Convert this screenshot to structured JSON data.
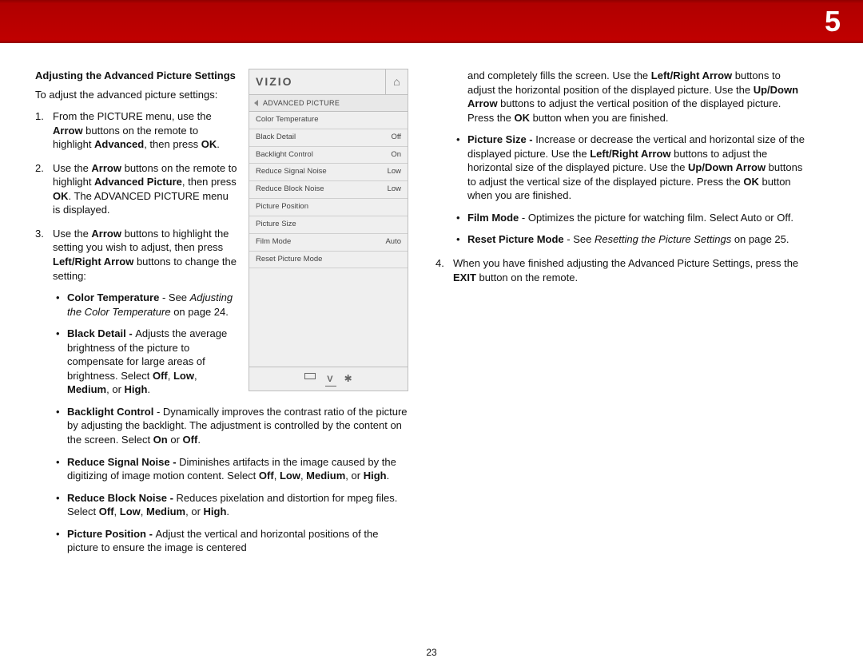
{
  "chapter": "5",
  "page_number": "23",
  "heading": "Adjusting the Advanced Picture Settings",
  "intro": "To adjust the advanced picture settings:",
  "steps": {
    "s1_a": "From the PICTURE menu, use the ",
    "s1_b": "Arrow",
    "s1_c": " buttons on the remote to highlight ",
    "s1_d": "Advanced",
    "s1_e": ", then press ",
    "s1_f": "OK",
    "s1_g": ".",
    "s2_a": "Use the ",
    "s2_b": "Arrow",
    "s2_c": " buttons on the remote to highlight ",
    "s2_d": "Advanced Picture",
    "s2_e": ", then press ",
    "s2_f": "OK",
    "s2_g": ". The ADVANCED PICTURE menu is displayed.",
    "s3_a": "Use the ",
    "s3_b": "Arrow",
    "s3_c": " buttons to highlight the setting you wish to adjust, then press ",
    "s3_d": "Left/Right Arrow",
    "s3_e": " buttons to change the setting:",
    "s4_a": "When you have finished adjusting the Advanced Picture Settings, press the ",
    "s4_b": "EXIT",
    "s4_c": " button on the remote."
  },
  "bullets_left": {
    "ct_a": "Color Temperature",
    "ct_b": " - See ",
    "ct_c": "Adjusting the Color Temperature",
    "ct_d": " on page 24.",
    "bd_a": "Black Detail - ",
    "bd_b": "Adjusts the average brightness of the picture to compensate for large areas of brightness. Select ",
    "bd_c": "Off",
    "bd_d": ", ",
    "bd_e": "Low",
    "bd_f": ", ",
    "bd_g": "Medium",
    "bd_h": ", or ",
    "bd_i": "High",
    "bd_j": ".",
    "bc_a": "Backlight Control",
    "bc_b": " - Dynamically improves the contrast ratio of the picture by adjusting the backlight. The adjustment is controlled by the content on the screen. Select ",
    "bc_c": "On",
    "bc_d": " or ",
    "bc_e": "Off",
    "bc_f": ".",
    "rsn_a": "Reduce Signal Noise - ",
    "rsn_b": "Diminishes artifacts in the image caused by the digitizing of image motion content. Select ",
    "rsn_c": "Off",
    "rsn_d": ", ",
    "rsn_e": "Low",
    "rsn_f": ", ",
    "rsn_g": "Medium",
    "rsn_h": ", or ",
    "rsn_i": "High",
    "rsn_j": ".",
    "rbn_a": "Reduce Block Noise - ",
    "rbn_b": "Reduces pixelation and distortion for mpeg files. Select ",
    "rbn_c": "Off",
    "rbn_d": ", ",
    "rbn_e": "Low",
    "rbn_f": ", ",
    "rbn_g": "Medium",
    "rbn_h": ", or ",
    "rbn_i": "High",
    "rbn_j": ".",
    "pp_a": "Picture Position - ",
    "pp_b": "Adjust the vertical and horizontal positions of the picture to ensure the image is centered"
  },
  "col2_cont": {
    "pp_c": "and completely fills the screen. Use the ",
    "pp_d": "Left/Right Arrow",
    "pp_e": " buttons to adjust the horizontal position of the displayed picture. Use the ",
    "pp_f": "Up/Down Arrow",
    "pp_g": " buttons to adjust the vertical position of the displayed picture. Press the ",
    "pp_h": "OK",
    "pp_i": " button when you are finished.",
    "ps_a": "Picture Size - ",
    "ps_b": "Increase or decrease the vertical and horizontal size of the displayed picture. Use the ",
    "ps_c": "Left/Right Arrow",
    "ps_d": " buttons to adjust the horizontal size of the displayed picture. Use the ",
    "ps_e": "Up/Down Arrow",
    "ps_f": " buttons to adjust the vertical size of the displayed picture. Press the ",
    "ps_g": "OK",
    "ps_h": " button when you are finished.",
    "fm_a": "Film Mode",
    "fm_b": " - Optimizes the picture for watching film. Select Auto or Off.",
    "rpm_a": "Reset Picture Mode",
    "rpm_b": " - See ",
    "rpm_c": "Resetting the Picture Settings",
    "rpm_d": " on page 25."
  },
  "menu": {
    "brand": "VIZIO",
    "crumb": "ADVANCED PICTURE",
    "rows": [
      {
        "label": "Color Temperature",
        "value": ""
      },
      {
        "label": "Black Detail",
        "value": "Off"
      },
      {
        "label": "Backlight Control",
        "value": "On"
      },
      {
        "label": "Reduce Signal Noise",
        "value": "Low"
      },
      {
        "label": "Reduce Block Noise",
        "value": "Low"
      },
      {
        "label": "Picture Position",
        "value": ""
      },
      {
        "label": "Picture Size",
        "value": ""
      },
      {
        "label": "Film Mode",
        "value": "Auto"
      },
      {
        "label": "Reset Picture Mode",
        "value": ""
      }
    ]
  }
}
